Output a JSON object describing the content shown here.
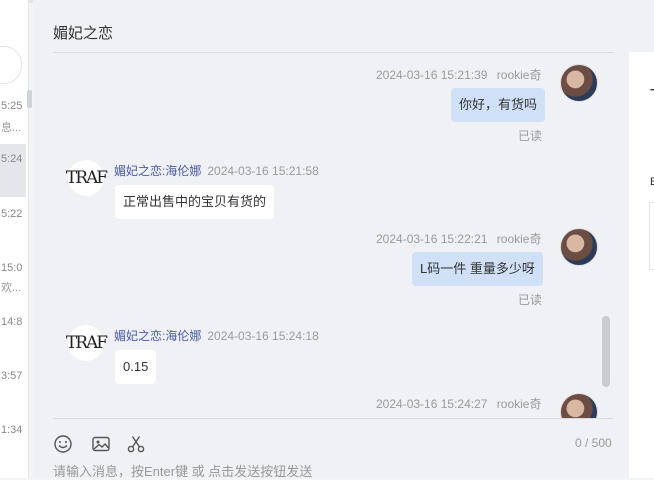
{
  "conversation": {
    "title": "媚妃之恋"
  },
  "sidebar": {
    "items": [
      {
        "time": "5:25",
        "snippet": "息..."
      },
      {
        "time": "5:24",
        "snippet": ""
      },
      {
        "time": "5:22",
        "snippet": ""
      },
      {
        "time": "15:0",
        "snippet": "欢..."
      },
      {
        "time": "14:8",
        "snippet": ""
      },
      {
        "time": "3:57",
        "snippet": ""
      },
      {
        "time": "1:34",
        "snippet": ""
      }
    ]
  },
  "messages": [
    {
      "sender": "rookie奇",
      "time": "2024-03-16 15:21:39",
      "text": "你好，有货吗",
      "status": "已读",
      "mine": true
    },
    {
      "sender": "媚妃之恋:海伦娜",
      "time": "2024-03-16 15:21:58",
      "text": "正常出售中的宝贝有货的",
      "mine": false
    },
    {
      "sender": "rookie奇",
      "time": "2024-03-16 15:22:21",
      "text": "L码一件 重量多少呀",
      "status": "已读",
      "mine": true
    },
    {
      "sender": "媚妃之恋:海伦娜",
      "time": "2024-03-16 15:24:18",
      "text": "0.15",
      "mine": false
    },
    {
      "sender": "rookie奇",
      "time": "2024-03-16 15:24:27",
      "mine": true
    }
  ],
  "shop_avatar_text": "TRAF",
  "composer": {
    "placeholder": "请输入消息，按Enter键 或 点击发送按钮发送",
    "counter": "0 / 500",
    "tools": [
      "emoji-icon",
      "image-icon",
      "scissors-icon"
    ]
  },
  "right_panel": {
    "letter": "T",
    "letter2": "E"
  }
}
